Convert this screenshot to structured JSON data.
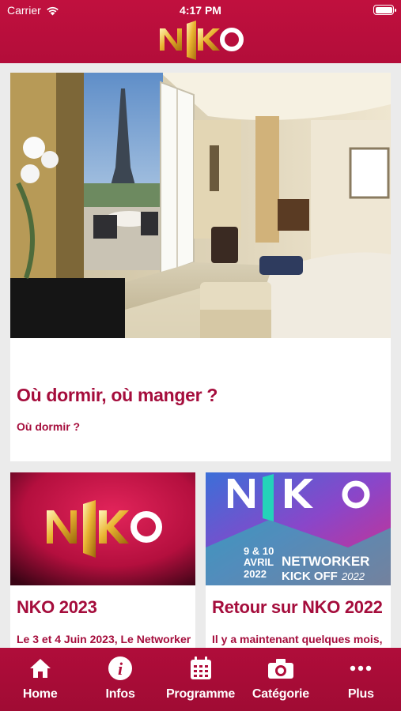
{
  "status_bar": {
    "carrier": "Carrier",
    "time": "4:17 PM"
  },
  "header": {
    "logo_text": "NKO"
  },
  "main": {
    "featured": {
      "title": "Où dormir, où manger ?",
      "subtitle": "Où dormir ?"
    },
    "cards": [
      {
        "title": "NKO 2023",
        "subtitle": "Le 3 et 4 Juin 2023, Le Networker"
      },
      {
        "title": "Retour sur NKO 2022",
        "subtitle": "Il y a maintenant quelques mois,",
        "poster_date_top": "9 & 10",
        "poster_month": "AVRIL",
        "poster_year": "2022",
        "poster_line1": "NETWORKER",
        "poster_line2": "KICK OFF",
        "poster_line2_year": "2022"
      }
    ]
  },
  "tabbar": {
    "items": [
      {
        "label": "Home",
        "icon": "home-icon"
      },
      {
        "label": "Infos",
        "icon": "info-icon"
      },
      {
        "label": "Programme",
        "icon": "calendar-icon"
      },
      {
        "label": "Catégorie",
        "icon": "camera-icon"
      },
      {
        "label": "Plus",
        "icon": "more-icon"
      }
    ]
  },
  "colors": {
    "brand": "#b30d3a",
    "text_accent": "#a50d3c",
    "background": "#ebebeb"
  }
}
